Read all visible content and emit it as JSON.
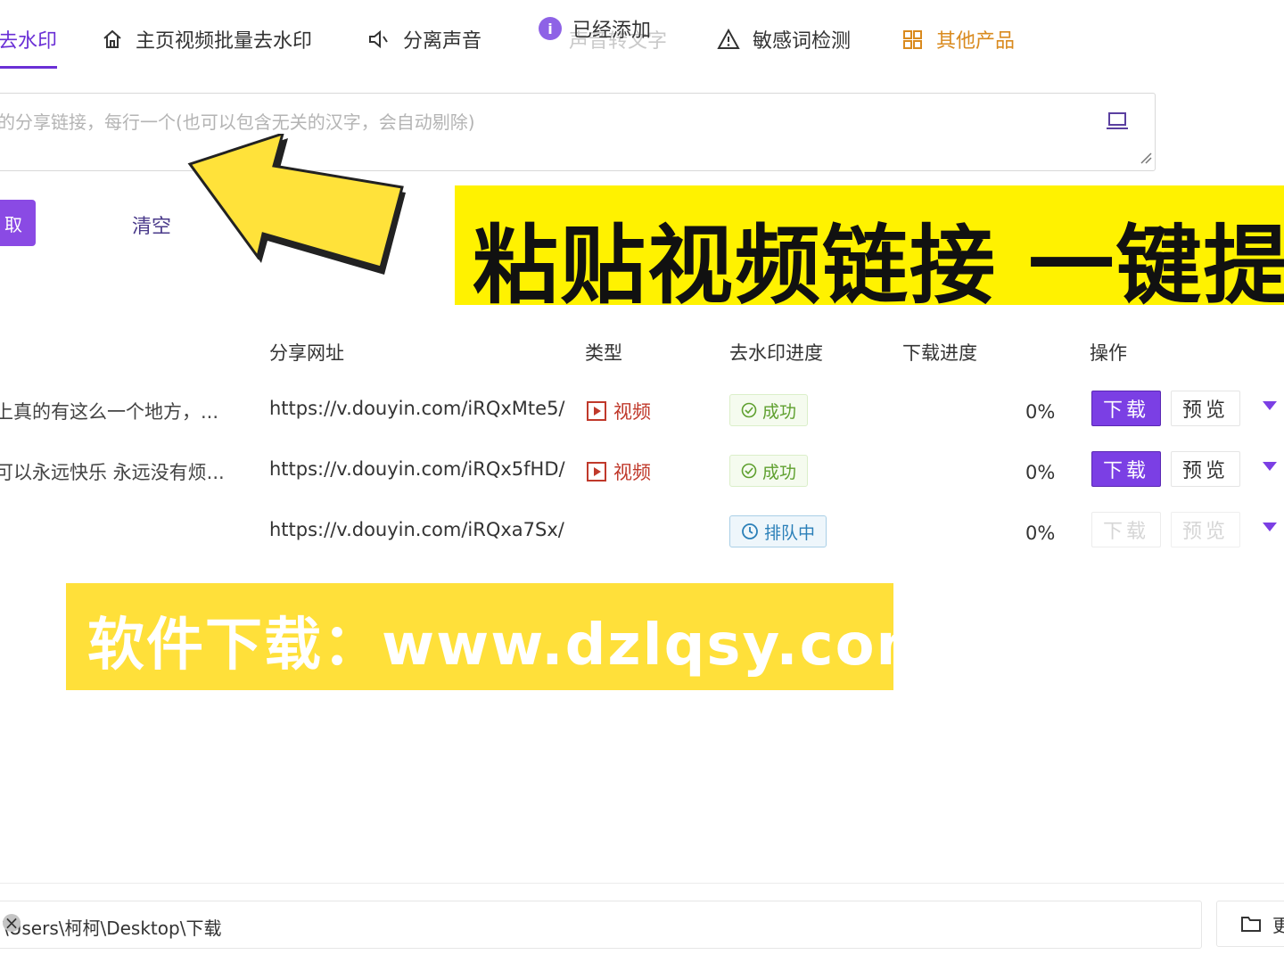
{
  "tabs": [
    {
      "label": "去水印"
    },
    {
      "label": "主页视频批量去水印"
    },
    {
      "label": "分离声音"
    },
    {
      "label": "声音转文字"
    },
    {
      "label": "敏感词检测"
    },
    {
      "label": "其他产品"
    }
  ],
  "toast": {
    "text": "已经添加"
  },
  "input": {
    "placeholder": "的分享链接，每行一个(也可以包含无关的汉字，会自动剔除)"
  },
  "actions": {
    "start_label": "取",
    "clear_label": "清空"
  },
  "banner_top": {
    "text": "粘贴视频链接   一键提"
  },
  "banner_bottom": {
    "text": "软件下载：www.dzlqsy.com"
  },
  "table": {
    "headers": {
      "url": "分享网址",
      "type": "类型",
      "progress": "去水印进度",
      "download": "下载进度",
      "ops": "操作"
    },
    "rows": [
      {
        "title": "上真的有这么一个地方，...",
        "url": "https://v.douyin.com/iRQxMte5/",
        "type": "视频",
        "status": "成功",
        "status_kind": "ok",
        "pct": "0%",
        "download_label": "下载",
        "preview_label": "预览",
        "enabled": true
      },
      {
        "title": "可以永远快乐 永远没有烦...",
        "url": "https://v.douyin.com/iRQx5fHD/",
        "type": "视频",
        "status": "成功",
        "status_kind": "ok",
        "pct": "0%",
        "download_label": "下载",
        "preview_label": "预览",
        "enabled": true
      },
      {
        "title": "",
        "url": "https://v.douyin.com/iRQxa7Sx/",
        "type": "",
        "status": "排队中",
        "status_kind": "queue",
        "pct": "0%",
        "download_label": "下载",
        "preview_label": "预览",
        "enabled": false
      }
    ]
  },
  "footer": {
    "path": "\\Users\\柯柯\\Desktop\\下载",
    "more_label": "更"
  },
  "icons": [
    "home-icon",
    "speaker-icon",
    "warning-icon",
    "apps-icon",
    "laptop-icon",
    "info-icon",
    "play-icon",
    "check-circle-icon",
    "clock-icon",
    "folder-icon",
    "clear-icon",
    "arrow-graphic"
  ],
  "colors": {
    "accent": "#7b3fe4",
    "success": "#5fa02f",
    "queue": "#2a7fb8",
    "video": "#c0392b",
    "banner_yellow": "#fff200",
    "other_products": "#d98a1e"
  }
}
